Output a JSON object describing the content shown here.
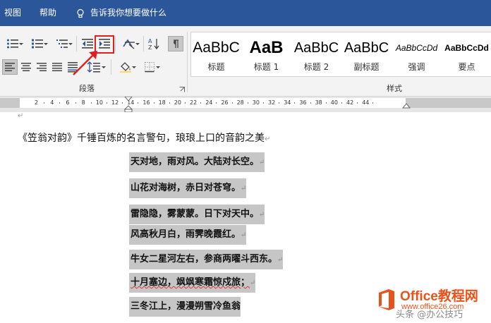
{
  "menubar": {
    "items": [
      "视图",
      "帮助"
    ],
    "tell_me": "告诉我你想要做什么"
  },
  "ribbon": {
    "paragraph_group_label": "段落",
    "styles_group_label": "样式",
    "styles": [
      {
        "sample": "AaBbC",
        "name": "标题"
      },
      {
        "sample": "AaB",
        "name": "标题 1"
      },
      {
        "sample": "AaBbC",
        "name": "标题 2"
      },
      {
        "sample": "AaBbC",
        "name": "副标题"
      },
      {
        "sample": "AaBbCcDd",
        "name": "强调"
      },
      {
        "sample": "AaBbCcDd",
        "name": "要点"
      }
    ]
  },
  "ruler": {
    "numbers": [
      "2",
      "4",
      "6",
      "8",
      "10",
      "12",
      "14",
      "16",
      "18",
      "20",
      "22",
      "24",
      "26",
      "28",
      "30",
      "32",
      "34",
      "36",
      "38",
      "40",
      "42",
      "44"
    ]
  },
  "document": {
    "lead": "《笠翁对韵》千锤百炼的名言警句，琅琅上口的音韵之美",
    "pilcrow": "↵",
    "poem": [
      "天对地，雨对风。大陆对长空。",
      "山花对海树，赤日对苍穹。",
      "雷隐隐，雾蒙蒙。日下对天中。",
      "风高秋月白，雨霁晚霞红。",
      "牛女二星河左右，参商两曜斗西东。",
      "十月塞边，飒飒寒霜惊戍旅；",
      "三冬江上，漫漫朔雪冷鱼翁"
    ]
  },
  "watermark": {
    "brand": "Office教程网",
    "url": "www.office26.com",
    "overlay": "头条 @办公技巧"
  },
  "colors": {
    "menubar": "#2b579a",
    "annotation": "#e02020",
    "selection": "#c6c6c6"
  }
}
